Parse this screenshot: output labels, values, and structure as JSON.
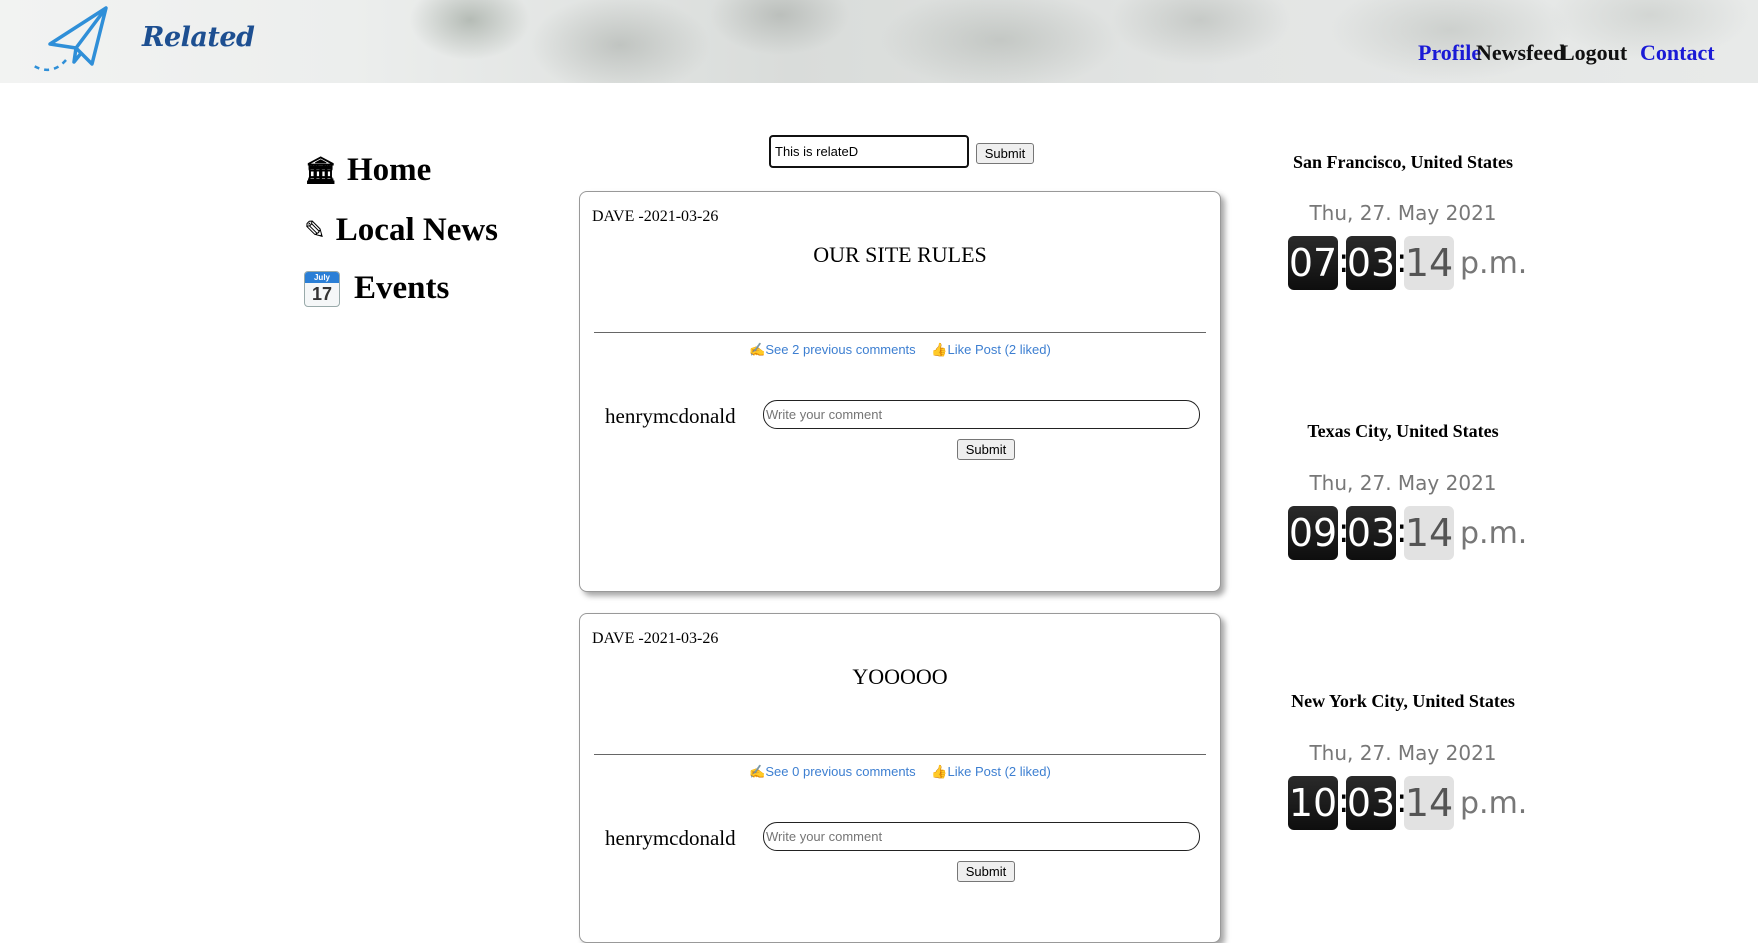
{
  "header": {
    "logo_text": "Related",
    "nav": [
      {
        "label": "Profile",
        "color": "#1a1ad6"
      },
      {
        "label": "Newsfeed",
        "color": "#111111"
      },
      {
        "label": "Logout",
        "color": "#111111"
      },
      {
        "label": "Contact",
        "color": "#1a1ad6"
      }
    ]
  },
  "sidebar": {
    "items": [
      {
        "icon": "home-icon",
        "glyph": "🏛",
        "label": "Home"
      },
      {
        "icon": "pencil-icon",
        "glyph": "✎",
        "label": "Local News"
      },
      {
        "icon": "calendar-icon",
        "cal_month": "July",
        "cal_day": "17",
        "label": "Events"
      }
    ]
  },
  "search": {
    "value": "This is relateD",
    "submit_label": "Submit"
  },
  "posts": [
    {
      "meta": "DAVE -2021-03-26",
      "title": "OUR SITE RULES",
      "comments_link": "✍See 2 previous comments",
      "like_link": "👍Like Post (2 liked)",
      "user": "henrymcdonald",
      "comment_placeholder": "Write your comment",
      "submit_label": "Submit"
    },
    {
      "meta": "DAVE -2021-03-26",
      "title": "YOOOOO",
      "comments_link": "✍See 0 previous comments",
      "like_link": "👍Like Post (2 liked)",
      "user": "henrymcdonald",
      "comment_placeholder": "Write your comment",
      "submit_label": "Submit"
    }
  ],
  "clocks": [
    {
      "city": "San Francisco, United States",
      "date": "Thu, 27. May 2021",
      "hours": "07",
      "minutes": "03",
      "seconds": "14",
      "ampm": "p.m."
    },
    {
      "city": "Texas City, United States",
      "date": "Thu, 27. May 2021",
      "hours": "09",
      "minutes": "03",
      "seconds": "14",
      "ampm": "p.m."
    },
    {
      "city": "New York City, United States",
      "date": "Thu, 27. May 2021",
      "hours": "10",
      "minutes": "03",
      "seconds": "14",
      "ampm": "p.m."
    }
  ]
}
